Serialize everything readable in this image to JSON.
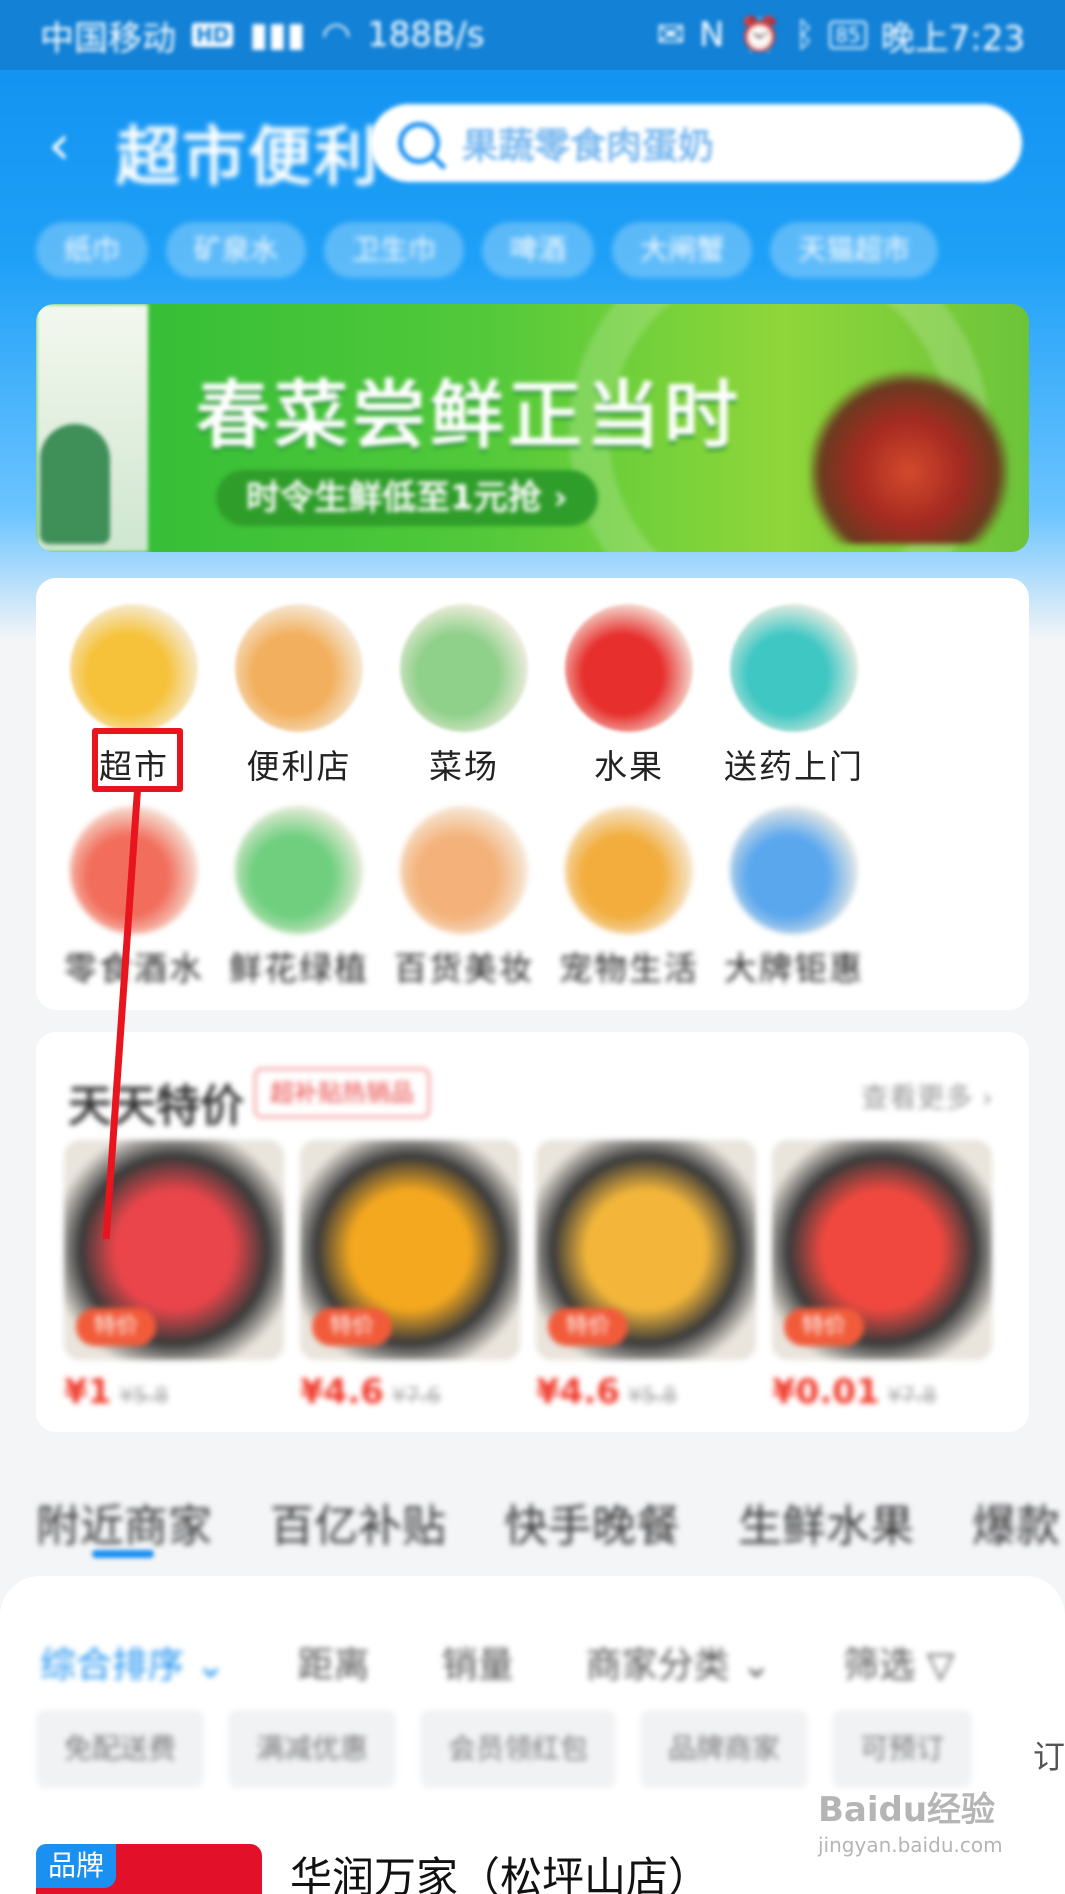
{
  "status_bar": {
    "carrier": "中国移动",
    "speed": "188B/s",
    "battery": "85",
    "time": "晚上7:23"
  },
  "header": {
    "title": "超市便利",
    "search_placeholder": "果蔬零食肉蛋奶"
  },
  "chips": [
    "纸巾",
    "矿泉水",
    "卫生巾",
    "啤酒",
    "大闸蟹",
    "天猫超市"
  ],
  "banner": {
    "title": "春菜尝鲜正当时",
    "subtitle": "时令生鲜低至1元抢 ›"
  },
  "categories_row1": [
    {
      "label": "超市",
      "icon": "grocery-icon",
      "color": "#f6c23a"
    },
    {
      "label": "便利店",
      "icon": "sandwich-icon",
      "color": "#f2b05e"
    },
    {
      "label": "菜场",
      "icon": "vegetable-icon",
      "color": "#8fd08a"
    },
    {
      "label": "水果",
      "icon": "apple-icon",
      "color": "#e7302e"
    },
    {
      "label": "送药上门",
      "icon": "medicine-box-icon",
      "color": "#3fc7c4"
    }
  ],
  "categories_row2": [
    {
      "label": "零食酒水",
      "icon": "drink-icon",
      "color": "#f26d5b"
    },
    {
      "label": "鲜花绿植",
      "icon": "flower-icon",
      "color": "#6fcf7f"
    },
    {
      "label": "百货美妆",
      "icon": "cosmetics-icon",
      "color": "#f4b27a"
    },
    {
      "label": "宠物生活",
      "icon": "pet-food-icon",
      "color": "#f2ad3d"
    },
    {
      "label": "大牌钜惠",
      "icon": "milk-icon",
      "color": "#5aa7ee"
    }
  ],
  "deals": {
    "title": "天天特价",
    "tag": "超补贴热销品",
    "more": "查看更多 ›",
    "items": [
      {
        "badge": "特价",
        "price": "¥1",
        "orig": "¥5.8",
        "color": "#e9454a"
      },
      {
        "badge": "特价",
        "price": "¥4.6",
        "orig": "¥7.6",
        "color": "#f4a81f"
      },
      {
        "badge": "特价",
        "price": "¥4.6",
        "orig": "¥5.8",
        "color": "#f3b63a"
      },
      {
        "badge": "特价",
        "price": "¥0.01",
        "orig": "¥7.8",
        "color": "#f0483f"
      }
    ]
  },
  "tabs": [
    "附近商家",
    "百亿补贴",
    "快手晚餐",
    "生鲜水果",
    "爆款"
  ],
  "sort": [
    "综合排序 ⌄",
    "距离",
    "销量",
    "商家分类 ⌄",
    "筛选 ▽"
  ],
  "filters": [
    "免配送费",
    "满减优惠",
    "会员领红包",
    "品牌商家",
    "可预订"
  ],
  "store": {
    "brand_badge": "品牌",
    "name": "华润万家（松坪山店）"
  },
  "edge_text": "订",
  "watermark": {
    "text": "Baidu经验",
    "url": "jingyan.baidu.com"
  }
}
